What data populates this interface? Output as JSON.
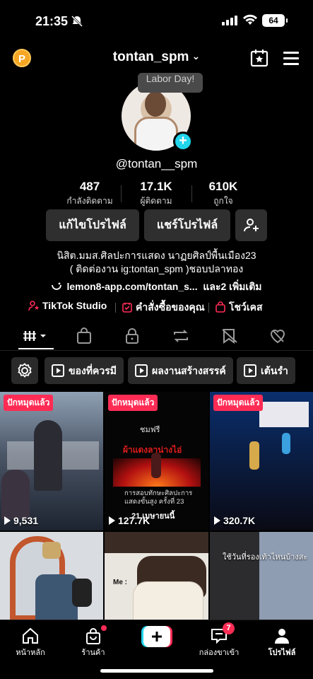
{
  "status": {
    "time": "21:35",
    "battery": "64"
  },
  "header": {
    "username": "tontan_spm",
    "coin_label": "P"
  },
  "profile": {
    "bubble_note": "Labor Day!",
    "handle": "@tontan__spm",
    "stats": [
      {
        "value": "487",
        "label": "กำลังติดตาม"
      },
      {
        "value": "17.1K",
        "label": "ผู้ติดตาม"
      },
      {
        "value": "610K",
        "label": "ถูกใจ"
      }
    ],
    "buttons": {
      "edit": "แก้ไขโปรไฟล์",
      "share": "แชร์โปรไฟล์"
    },
    "bio_line1": "นิสิต.มมส.ศิลปะการแสดง นาฏยศิลป์พื้นเมือง23",
    "bio_line2": "( ติดต่องาน ig:tontan_spm )ชอบปลาทอง",
    "link": "lemon8-app.com/tontan_s...",
    "link_more": "และ2 เพิ่มเติม",
    "shortcuts": [
      "TikTok Studio",
      "คำสั่งซื้อของคุณ",
      "โชว์เคส"
    ]
  },
  "chips": [
    "ของที่ควรมี",
    "ผลงานสร้างสรรค์",
    "เต้นรำ"
  ],
  "videos": [
    {
      "pinned": "ปักหมุดแล้ว",
      "views": "9,531",
      "overlay": ""
    },
    {
      "pinned": "ปักหมุดแล้ว",
      "views": "127.7K",
      "overlay_top": "ชมฟรี",
      "overlay_sub": "ผ้าแดงลาน่างไอ่",
      "caption1": "การสอบทักษะศิลปะการ",
      "caption2": "แสดงขั้นสูง ครั้งที่ 23",
      "caption3": "21 เมษายนนี้"
    },
    {
      "pinned": "ปักหมุดแล้ว",
      "views": "320.7K",
      "overlay": ""
    },
    {
      "pinned": "",
      "views": "",
      "overlay": ""
    },
    {
      "pinned": "",
      "views": "",
      "overlay": "Me :"
    },
    {
      "pinned": "",
      "views": "",
      "overlay": "ใช้วันที่รองเท้าไหนบ้างสะ"
    }
  ],
  "nav": {
    "home": "หน้าหลัก",
    "shop": "ร้านค้า",
    "inbox": "กล่องขาเข้า",
    "inbox_badge": "7",
    "profile": "โปรไฟล์"
  },
  "colors": {
    "accent_red": "#fe2c55",
    "accent_cyan": "#20d5ec",
    "coin": "#f5a623"
  }
}
